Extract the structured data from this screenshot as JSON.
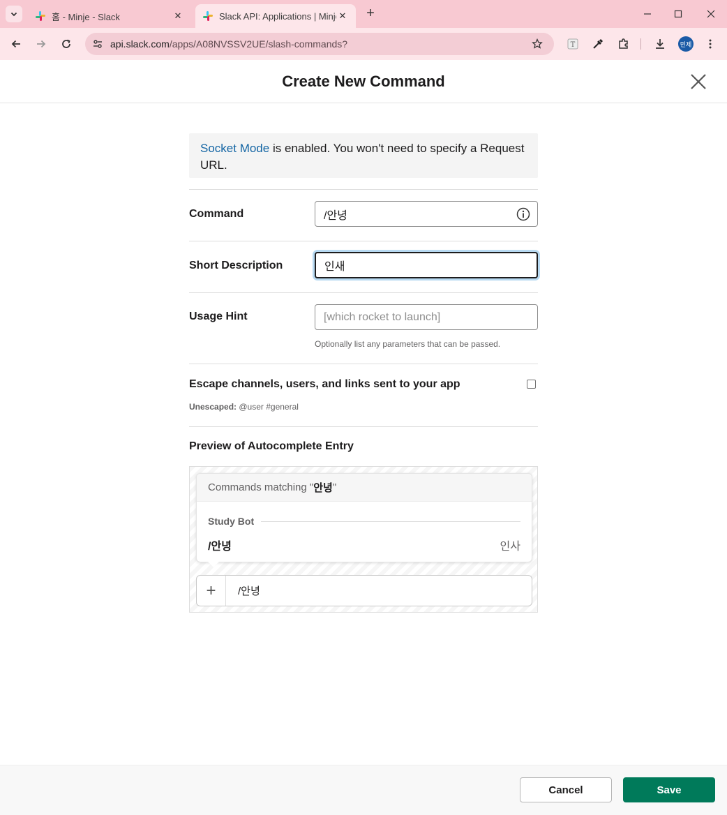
{
  "browser": {
    "tabs": [
      {
        "title": "홈 - Minje - Slack",
        "active": false
      },
      {
        "title": "Slack API: Applications | Minje",
        "active": true
      }
    ],
    "url_host": "api.slack.com",
    "url_path": "/apps/A08NVSSV2UE/slash-commands?",
    "profile_initials": "민제"
  },
  "modal": {
    "title": "Create New Command",
    "notice": {
      "link_text": "Socket Mode",
      "text": " is enabled. You won't need to specify a Request URL."
    },
    "fields": {
      "command": {
        "label": "Command",
        "value": "/안녕"
      },
      "short_description": {
        "label": "Short Description",
        "value": "인새"
      },
      "usage_hint": {
        "label": "Usage Hint",
        "placeholder": "[which rocket to launch]",
        "help": "Optionally list any parameters that can be passed."
      }
    },
    "escape": {
      "label": "Escape channels, users, and links sent to your app",
      "checked": false,
      "unescaped_label": "Unescaped:",
      "unescaped_example": " @user #general"
    },
    "preview": {
      "heading": "Preview of Autocomplete Entry",
      "header_prefix": "Commands matching \"",
      "header_query": "안녕",
      "header_suffix": "\"",
      "app_name": "Study Bot",
      "command": "/안녕",
      "description": "인사",
      "composer_text": "/안녕"
    },
    "buttons": {
      "cancel": "Cancel",
      "save": "Save"
    }
  },
  "colors": {
    "accent_link": "#1264a3",
    "save_button": "#007a5a",
    "tab_bar": "#f8c9d2"
  }
}
